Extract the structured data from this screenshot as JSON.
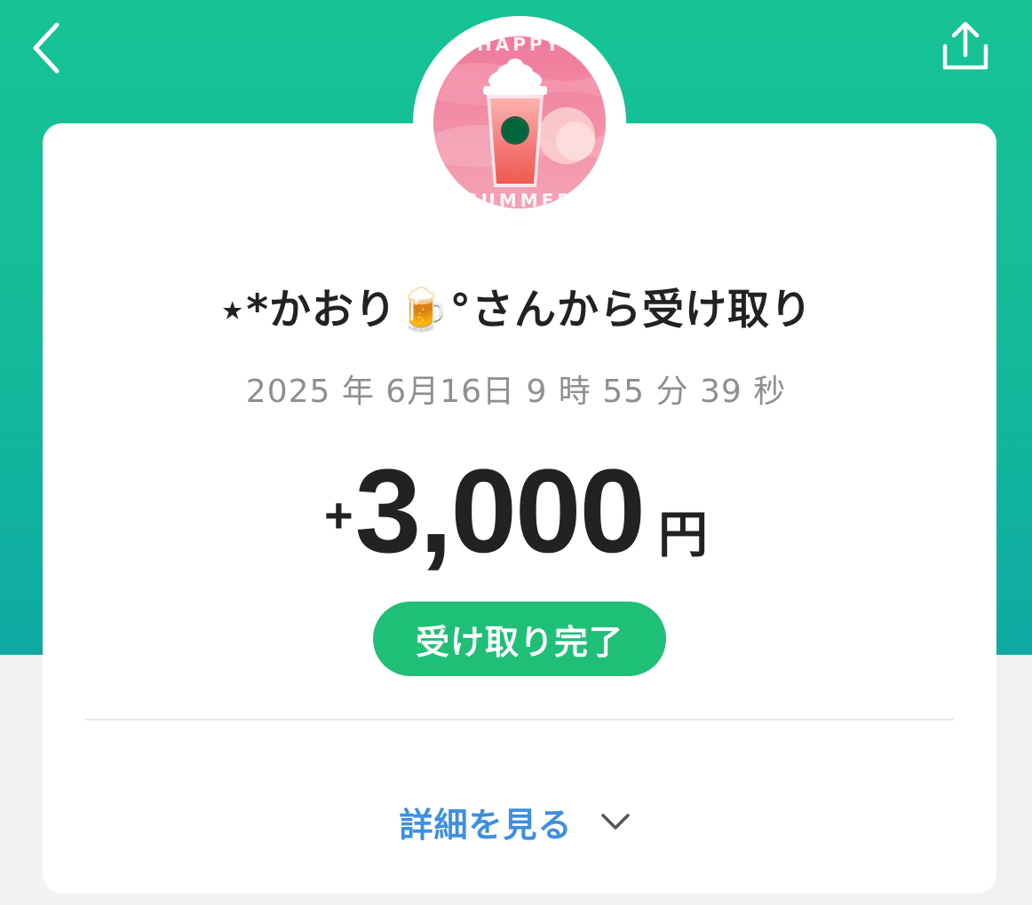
{
  "header": {
    "back_icon": "chevron-left-icon",
    "share_icon": "share-icon",
    "background_color": "#15be97"
  },
  "transaction": {
    "title": "⋆*かおり🍺°さんから受け取り",
    "datetime": "2025 年 6月16日 9 時 55 分 39 秒",
    "amount_sign": "+",
    "amount_value": "3,000",
    "amount_unit": "円",
    "status": "受け取り完了",
    "status_color": "#1fbf77"
  },
  "details": {
    "label": "詳細を見る",
    "icon": "chevron-down-icon",
    "color": "#3d8fe0"
  }
}
